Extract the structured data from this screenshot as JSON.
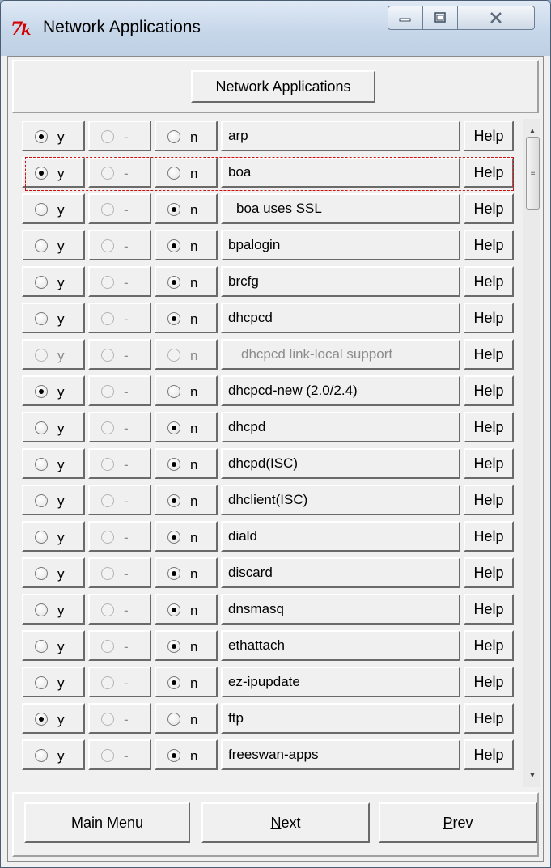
{
  "window": {
    "title": "Network Applications",
    "icon": "tk-feather-icon"
  },
  "titlebar_buttons": {
    "minimize": "minimize-icon",
    "maximize": "maximize-icon",
    "close": "close-icon"
  },
  "header_button": "Network Applications",
  "columns": {
    "yes": "y",
    "module": "-",
    "no": "n"
  },
  "help_label": "Help",
  "rows": [
    {
      "name": "arp",
      "selected": "y",
      "disabled": false
    },
    {
      "name": "boa",
      "selected": "y",
      "disabled": false,
      "focused": true
    },
    {
      "name": "boa uses SSL",
      "selected": "n",
      "disabled": false,
      "indent": true
    },
    {
      "name": "bpalogin",
      "selected": "n",
      "disabled": false
    },
    {
      "name": "brcfg",
      "selected": "n",
      "disabled": false
    },
    {
      "name": "dhcpcd",
      "selected": "n",
      "disabled": false
    },
    {
      "name": "dhcpcd link-local support",
      "selected": "",
      "disabled": true,
      "indent": true
    },
    {
      "name": "dhcpcd-new (2.0/2.4)",
      "selected": "y",
      "disabled": false
    },
    {
      "name": "dhcpd",
      "selected": "n",
      "disabled": false
    },
    {
      "name": "dhcpd(ISC)",
      "selected": "n",
      "disabled": false
    },
    {
      "name": "dhclient(ISC)",
      "selected": "n",
      "disabled": false
    },
    {
      "name": "diald",
      "selected": "n",
      "disabled": false
    },
    {
      "name": "discard",
      "selected": "n",
      "disabled": false
    },
    {
      "name": "dnsmasq",
      "selected": "n",
      "disabled": false
    },
    {
      "name": "ethattach",
      "selected": "n",
      "disabled": false
    },
    {
      "name": "ez-ipupdate",
      "selected": "n",
      "disabled": false
    },
    {
      "name": "ftp",
      "selected": "y",
      "disabled": false
    },
    {
      "name": "freeswan-apps",
      "selected": "n",
      "disabled": false
    }
  ],
  "footer": {
    "main_menu": "Main Menu",
    "next": "Next",
    "next_mnemonic": "N",
    "next_rest": "ext",
    "prev": "Prev",
    "prev_mnemonic": "P",
    "prev_rest": "rev"
  },
  "colors": {
    "focus_outline": "#d01010",
    "disabled_text": "#8c8c8c",
    "logo_red": "#d40000"
  }
}
